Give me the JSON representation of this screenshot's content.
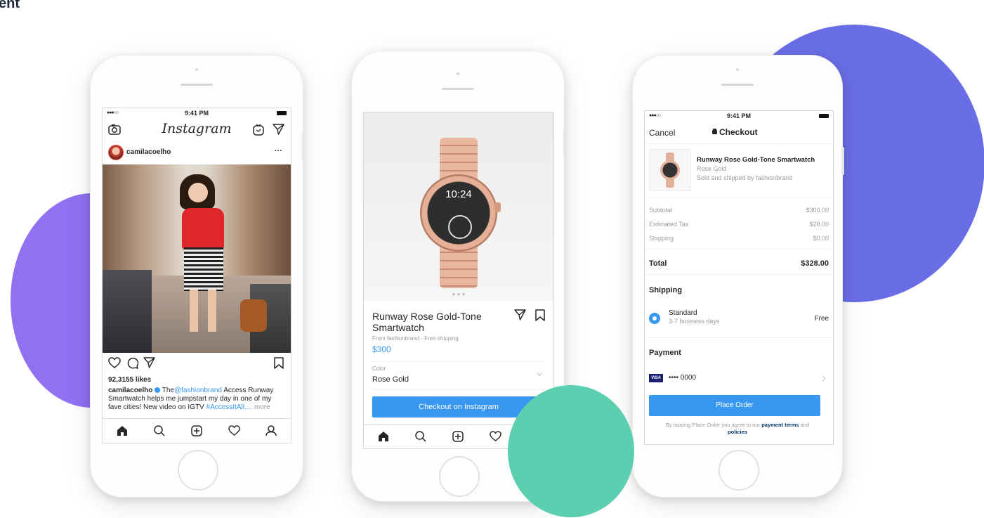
{
  "header": {
    "word": "ent"
  },
  "colors": {
    "purple": "#8f71f2",
    "indigo": "#6a6ee6",
    "teal": "#5ccfb0",
    "link": "#3897f0"
  },
  "feed": {
    "status_time": "9:41 PM",
    "logo": "Instagram",
    "username": "camilacoelho",
    "more": "···",
    "likes": "92,3155 likes",
    "caption_user": "camilacoelho",
    "caption_mention": "@fashionbrand",
    "caption_text_1": " Access Runway",
    "caption_line2": "Smartwatch helps me jumpstart my day in one of my",
    "caption_line3_a": "fave cities! New video on IGTV ",
    "caption_hashtag": "#AccessItAll....",
    "caption_more": " more",
    "icons": {
      "camera": "camera-icon",
      "igtv": "igtv-icon",
      "direct": "direct-send-icon",
      "like": "heart-icon",
      "comment": "comment-icon",
      "share": "share-icon",
      "save": "bookmark-icon",
      "verified": "verified-badge-icon"
    }
  },
  "product": {
    "watch_time": "10:24",
    "title_line1": "Runway Rose Gold-Tone",
    "title_line2": "Smartwatch",
    "subtitle": "From fashionbrand · Free shipping",
    "price": "$300",
    "color_label": "Color",
    "color_value": "Rose Gold",
    "checkout_label": "Checkout on Instagram"
  },
  "checkout": {
    "status_time": "9:41 PM",
    "cancel": "Cancel",
    "title": "Checkout",
    "item_name": "Runway Rose Gold-Tone Smartwatch",
    "item_variant": "Rose Gold",
    "item_seller": "Sold and shipped by fashionbrand",
    "rows": [
      {
        "label": "Subtotal",
        "value": "$300.00"
      },
      {
        "label": "Estimated Tax",
        "value": "$28.00"
      },
      {
        "label": "Shipping",
        "value": "$0.00"
      }
    ],
    "total_label": "Total",
    "total_value": "$328.00",
    "shipping_heading": "Shipping",
    "ship_option": "Standard",
    "ship_days": "3-7 business days",
    "ship_price": "Free",
    "payment_heading": "Payment",
    "card_brand": "VISA",
    "card_number": "•••• 0000",
    "place_order": "Place Order",
    "terms_prefix": "By tapping Place Order you agree to our ",
    "terms_link1": "payment terms",
    "terms_and": " and",
    "terms_link2": "policies"
  },
  "tabs": {
    "home": "home-icon",
    "search": "search-icon",
    "add": "add-post-icon",
    "activity": "heart-icon",
    "profile": "profile-icon"
  }
}
